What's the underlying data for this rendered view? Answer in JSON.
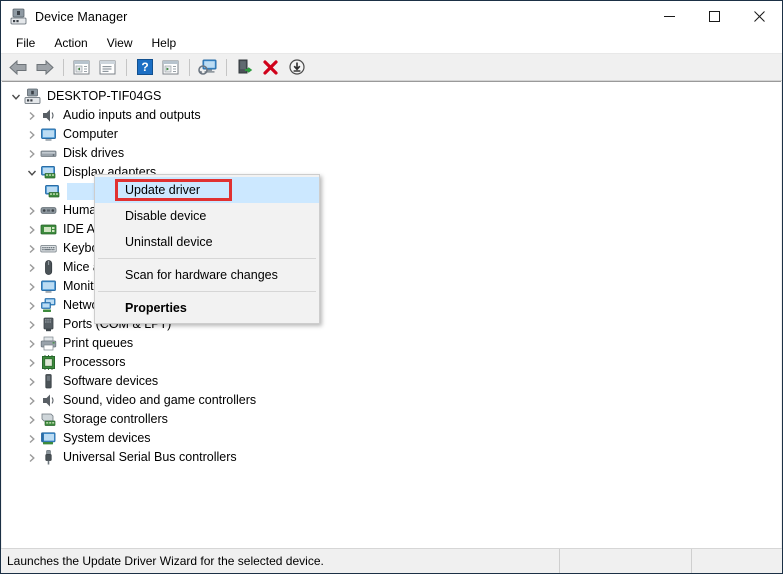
{
  "window": {
    "title": "Device Manager",
    "app_icon": "device-manager-icon",
    "controls": {
      "minimize": "—",
      "maximize": "☐",
      "close": "✕"
    }
  },
  "menubar": {
    "items": [
      {
        "label": "File",
        "name": "menu-file"
      },
      {
        "label": "Action",
        "name": "menu-action"
      },
      {
        "label": "View",
        "name": "menu-view"
      },
      {
        "label": "Help",
        "name": "menu-help"
      }
    ]
  },
  "toolbar": {
    "buttons": [
      {
        "icon": "back-arrow-icon",
        "name": "toolbar-back"
      },
      {
        "icon": "forward-arrow-icon",
        "name": "toolbar-forward"
      },
      {
        "icon": "separator",
        "name": "toolbar-separator-1"
      },
      {
        "icon": "show-hidden-devices-icon",
        "name": "toolbar-show-hidden-devices"
      },
      {
        "icon": "properties-window-icon",
        "name": "toolbar-properties"
      },
      {
        "icon": "separator",
        "name": "toolbar-separator-2"
      },
      {
        "icon": "help-question-icon",
        "name": "toolbar-help"
      },
      {
        "icon": "update-driver-icon",
        "name": "toolbar-update-driver"
      },
      {
        "icon": "separator",
        "name": "toolbar-separator-3"
      },
      {
        "icon": "scan-hardware-changes-icon",
        "name": "toolbar-scan-hardware-changes"
      },
      {
        "icon": "separator",
        "name": "toolbar-separator-4"
      },
      {
        "icon": "enable-device-icon",
        "name": "toolbar-enable-device"
      },
      {
        "icon": "uninstall-device-icon",
        "name": "toolbar-uninstall-device"
      },
      {
        "icon": "download-driver-icon",
        "name": "toolbar-download"
      }
    ]
  },
  "tree": {
    "root": {
      "label": "DESKTOP-TIF04GS",
      "icon": "computer-root-icon",
      "expanded": true
    },
    "items": [
      {
        "label": "Audio inputs and outputs",
        "icon": "speaker-icon",
        "expanded": false
      },
      {
        "label": "Computer",
        "icon": "monitor-icon",
        "expanded": false
      },
      {
        "label": "Disk drives",
        "icon": "disk-drive-icon",
        "expanded": false
      },
      {
        "label": "Display adapters",
        "icon": "display-adapter-icon",
        "expanded": true
      },
      {
        "label": "Human Interface Devices",
        "icon": "hid-icon",
        "expanded": false
      },
      {
        "label": "IDE ATA/ATAPI controllers",
        "icon": "ide-controller-icon",
        "expanded": false
      },
      {
        "label": "Keyboards",
        "icon": "keyboard-icon",
        "expanded": false
      },
      {
        "label": "Mice and other pointing devices",
        "icon": "mouse-icon",
        "expanded": false
      },
      {
        "label": "Monitors",
        "icon": "monitor-icon",
        "expanded": false
      },
      {
        "label": "Network adapters",
        "icon": "network-adapter-icon",
        "expanded": false
      },
      {
        "label": "Ports (COM & LPT)",
        "icon": "port-icon",
        "expanded": false
      },
      {
        "label": "Print queues",
        "icon": "printer-icon",
        "expanded": false
      },
      {
        "label": "Processors",
        "icon": "processor-icon",
        "expanded": false
      },
      {
        "label": "Software devices",
        "icon": "software-device-icon",
        "expanded": false
      },
      {
        "label": "Sound, video and game controllers",
        "icon": "speaker-icon",
        "expanded": false
      },
      {
        "label": "Storage controllers",
        "icon": "storage-controller-icon",
        "expanded": false
      },
      {
        "label": "System devices",
        "icon": "system-device-icon",
        "expanded": false
      },
      {
        "label": "Universal Serial Bus controllers",
        "icon": "usb-icon",
        "expanded": false
      }
    ],
    "selected_child": {
      "label": "",
      "icon": "display-adapter-icon",
      "parent": "Display adapters"
    }
  },
  "context_menu": {
    "items": [
      {
        "label": "Update driver",
        "highlighted": true,
        "bold": false,
        "name": "ctx-update-driver"
      },
      {
        "label": "Disable device",
        "highlighted": false,
        "bold": false,
        "name": "ctx-disable-device"
      },
      {
        "label": "Uninstall device",
        "highlighted": false,
        "bold": false,
        "name": "ctx-uninstall-device"
      },
      {
        "label": "separator",
        "highlighted": false,
        "bold": false,
        "name": "ctx-separator-1"
      },
      {
        "label": "Scan for hardware changes",
        "highlighted": false,
        "bold": false,
        "name": "ctx-scan-hardware-changes"
      },
      {
        "label": "separator",
        "highlighted": false,
        "bold": false,
        "name": "ctx-separator-2"
      },
      {
        "label": "Properties",
        "highlighted": false,
        "bold": true,
        "name": "ctx-properties"
      }
    ]
  },
  "annotation": {
    "type": "red-rectangle-highlight",
    "target": "Update driver",
    "color": "#e03131"
  },
  "statusbar": {
    "message": "Launches the Update Driver Wizard for the selected device.",
    "panel2": "",
    "panel3": ""
  },
  "colors": {
    "selection": "#cce8ff",
    "annotation": "#e03131",
    "window_bg": "#f0f0f0",
    "content_bg": "#ffffff",
    "border": "#1b3045"
  }
}
